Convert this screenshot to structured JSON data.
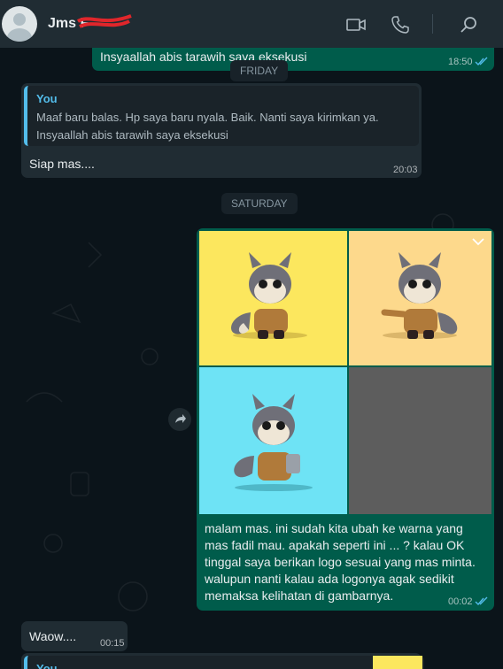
{
  "header": {
    "contact_name": "Jms F",
    "icons": [
      "video-call-icon",
      "voice-call-icon",
      "search-icon"
    ]
  },
  "messages": [
    {
      "id": "m1",
      "type": "outgoing",
      "text": "Insyaallah abis tarawih saya eksekusi",
      "time": "18:50",
      "status": "read"
    },
    {
      "id": "d1",
      "type": "day",
      "label": "FRIDAY"
    },
    {
      "id": "m2",
      "type": "incoming",
      "quote_author": "You",
      "quote_lines": [
        "Maaf baru balas. Hp saya baru nyala. Baik. Nanti saya kirimkan ya.",
        "Insyaallah abis tarawih saya eksekusi"
      ],
      "text": "Siap mas....",
      "time": "20:03"
    },
    {
      "id": "d2",
      "type": "day",
      "label": "SATURDAY"
    },
    {
      "id": "m3",
      "type": "outgoing",
      "lines": [
        "malam mas. ini sudah kita ubah ke warna yang",
        "mas fadil mau. apakah seperti ini ... ? kalau OK",
        "tinggal saya berikan logo sesuai yang mas minta.",
        "walupun nanti kalau ada logonya agak sedikit",
        "memaksa kelihatan di gambarnya."
      ],
      "time": "00:02",
      "status": "read",
      "image_tiles": [
        {
          "bg": "#fce75e"
        },
        {
          "bg": "#fdd98c"
        },
        {
          "bg": "#6ee3f5"
        },
        {
          "bg": "#5d5d5d"
        }
      ]
    },
    {
      "id": "m4",
      "type": "incoming",
      "text": "Waow....",
      "time": "00:15"
    },
    {
      "id": "m5",
      "type": "incoming",
      "quote_author": "You"
    }
  ],
  "colors": {
    "outgoing": "#005c4b",
    "incoming": "#202c33",
    "accent": "#53bdeb"
  }
}
